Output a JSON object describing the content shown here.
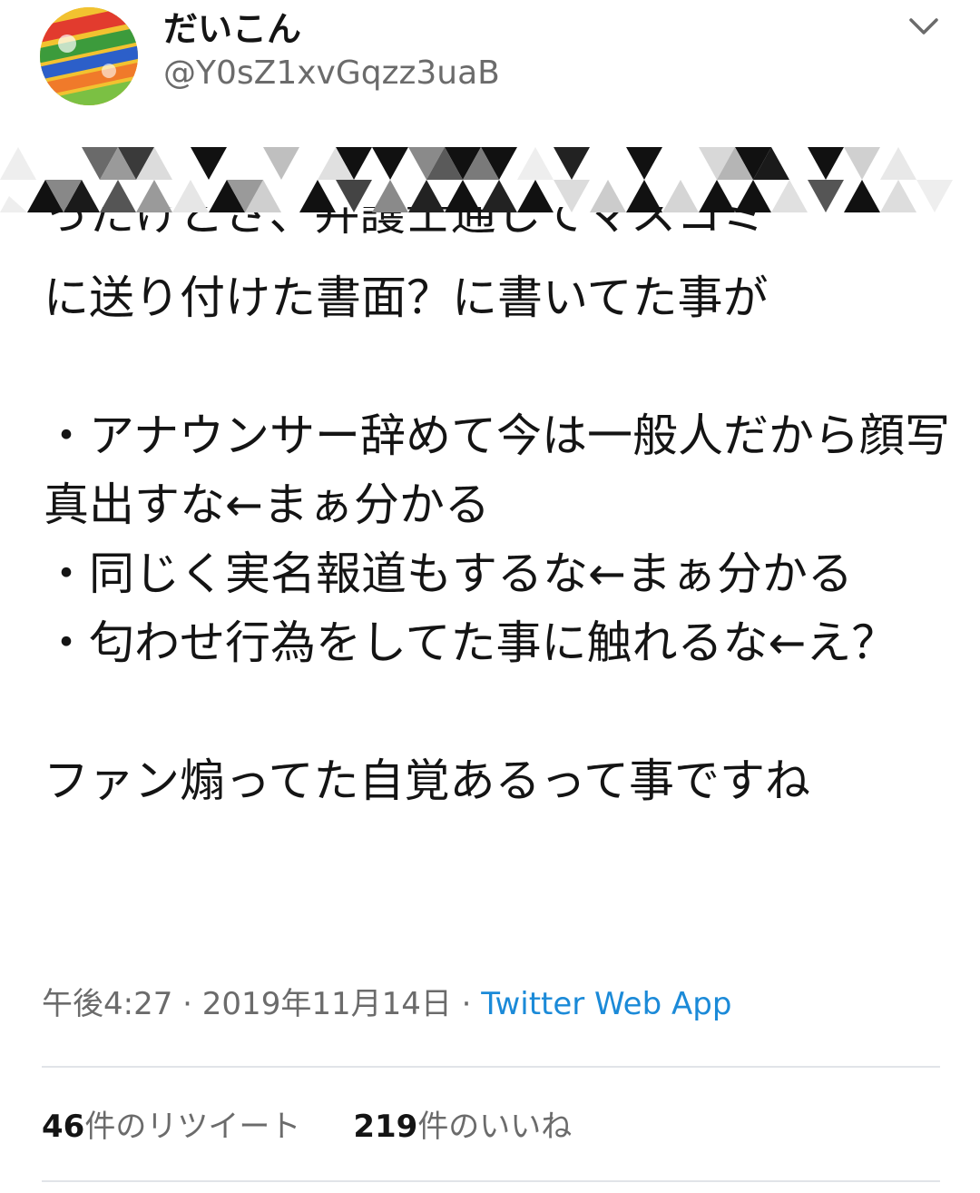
{
  "user": {
    "display_name": "だいこん",
    "handle": "@Y0sZ1xvGqzz3uaB"
  },
  "tweet": {
    "partial_top_line": "ったけどさ、弁護士通してマスコミ",
    "body": "に送り付けた書面？に書いてた事が\n\n・アナウンサー辞めて今は一般人だから顔写真出すな←まぁ分かる\n・同じく実名報道もするな←まぁ分かる\n・匂わせ行為をしてた事に触れるな←え？\n\nファン煽ってた自覚あるって事ですね"
  },
  "meta": {
    "time": "午後4:27",
    "separator1": "·",
    "date": "2019年11月14日",
    "separator2": "·",
    "source": "Twitter Web App"
  },
  "stats": {
    "retweet_count": "46",
    "retweet_label": "件のリツイート",
    "like_count": "219",
    "like_label": "件のいいね"
  },
  "icons": {
    "menu": "chevron-down-icon",
    "avatar": "avatar-image"
  }
}
